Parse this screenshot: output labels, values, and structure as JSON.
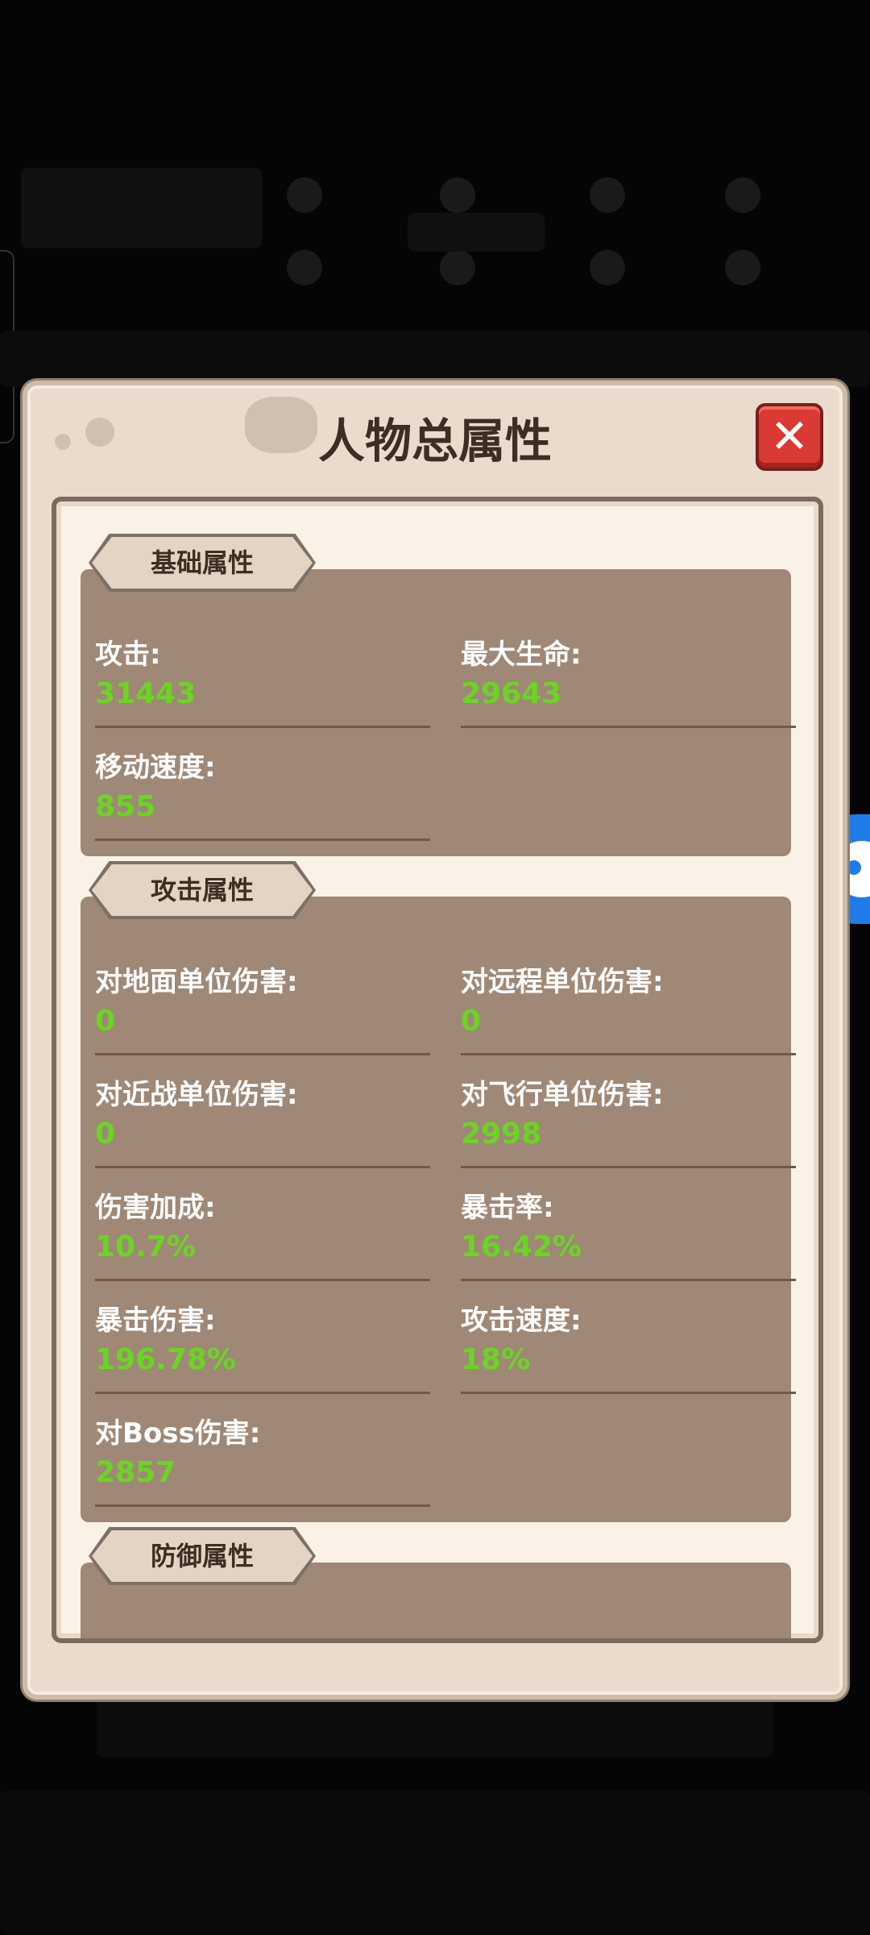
{
  "dialog": {
    "title": "人物总属性",
    "close_icon": "close-x-icon"
  },
  "sections": {
    "basic": {
      "tab": "基础属性",
      "stats": [
        {
          "label": "攻击:",
          "value": "31443"
        },
        {
          "label": "最大生命:",
          "value": "29643"
        },
        {
          "label": "移动速度:",
          "value": "855"
        }
      ]
    },
    "attack": {
      "tab": "攻击属性",
      "stats": [
        {
          "label": "对地面单位伤害:",
          "value": "0"
        },
        {
          "label": "对远程单位伤害:",
          "value": "0"
        },
        {
          "label": "对近战单位伤害:",
          "value": "0"
        },
        {
          "label": "对飞行单位伤害:",
          "value": "2998"
        },
        {
          "label": "伤害加成:",
          "value": "10.7%"
        },
        {
          "label": "暴击率:",
          "value": "16.42%"
        },
        {
          "label": "暴击伤害:",
          "value": "196.78%"
        },
        {
          "label": "攻击速度:",
          "value": "18%"
        },
        {
          "label": "对Boss伤害:",
          "value": "2857"
        }
      ]
    },
    "defense": {
      "tab": "防御属性"
    }
  },
  "colors": {
    "value_green": "#6ad522",
    "panel_brown": "#a08876",
    "close_red": "#d93a33",
    "float_button_blue": "#1f7be8"
  },
  "floating_button": {
    "icon": "gamepad-icon"
  }
}
